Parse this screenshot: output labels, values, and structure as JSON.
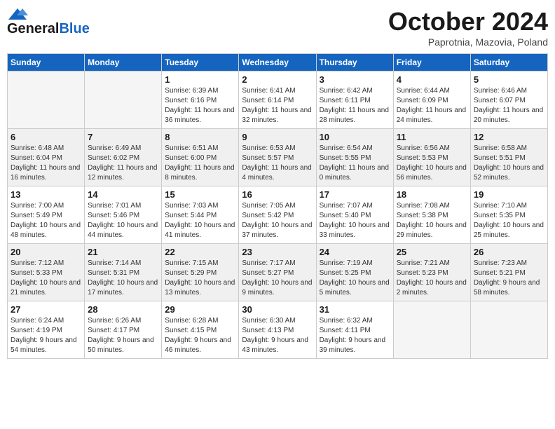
{
  "header": {
    "logo_line1": "General",
    "logo_line2": "Blue",
    "month": "October 2024",
    "location": "Paprotnia, Mazovia, Poland"
  },
  "weekdays": [
    "Sunday",
    "Monday",
    "Tuesday",
    "Wednesday",
    "Thursday",
    "Friday",
    "Saturday"
  ],
  "weeks": [
    [
      {
        "day": "",
        "sunrise": "",
        "sunset": "",
        "daylight": ""
      },
      {
        "day": "",
        "sunrise": "",
        "sunset": "",
        "daylight": ""
      },
      {
        "day": "1",
        "sunrise": "Sunrise: 6:39 AM",
        "sunset": "Sunset: 6:16 PM",
        "daylight": "Daylight: 11 hours and 36 minutes."
      },
      {
        "day": "2",
        "sunrise": "Sunrise: 6:41 AM",
        "sunset": "Sunset: 6:14 PM",
        "daylight": "Daylight: 11 hours and 32 minutes."
      },
      {
        "day": "3",
        "sunrise": "Sunrise: 6:42 AM",
        "sunset": "Sunset: 6:11 PM",
        "daylight": "Daylight: 11 hours and 28 minutes."
      },
      {
        "day": "4",
        "sunrise": "Sunrise: 6:44 AM",
        "sunset": "Sunset: 6:09 PM",
        "daylight": "Daylight: 11 hours and 24 minutes."
      },
      {
        "day": "5",
        "sunrise": "Sunrise: 6:46 AM",
        "sunset": "Sunset: 6:07 PM",
        "daylight": "Daylight: 11 hours and 20 minutes."
      }
    ],
    [
      {
        "day": "6",
        "sunrise": "Sunrise: 6:48 AM",
        "sunset": "Sunset: 6:04 PM",
        "daylight": "Daylight: 11 hours and 16 minutes."
      },
      {
        "day": "7",
        "sunrise": "Sunrise: 6:49 AM",
        "sunset": "Sunset: 6:02 PM",
        "daylight": "Daylight: 11 hours and 12 minutes."
      },
      {
        "day": "8",
        "sunrise": "Sunrise: 6:51 AM",
        "sunset": "Sunset: 6:00 PM",
        "daylight": "Daylight: 11 hours and 8 minutes."
      },
      {
        "day": "9",
        "sunrise": "Sunrise: 6:53 AM",
        "sunset": "Sunset: 5:57 PM",
        "daylight": "Daylight: 11 hours and 4 minutes."
      },
      {
        "day": "10",
        "sunrise": "Sunrise: 6:54 AM",
        "sunset": "Sunset: 5:55 PM",
        "daylight": "Daylight: 11 hours and 0 minutes."
      },
      {
        "day": "11",
        "sunrise": "Sunrise: 6:56 AM",
        "sunset": "Sunset: 5:53 PM",
        "daylight": "Daylight: 10 hours and 56 minutes."
      },
      {
        "day": "12",
        "sunrise": "Sunrise: 6:58 AM",
        "sunset": "Sunset: 5:51 PM",
        "daylight": "Daylight: 10 hours and 52 minutes."
      }
    ],
    [
      {
        "day": "13",
        "sunrise": "Sunrise: 7:00 AM",
        "sunset": "Sunset: 5:49 PM",
        "daylight": "Daylight: 10 hours and 48 minutes."
      },
      {
        "day": "14",
        "sunrise": "Sunrise: 7:01 AM",
        "sunset": "Sunset: 5:46 PM",
        "daylight": "Daylight: 10 hours and 44 minutes."
      },
      {
        "day": "15",
        "sunrise": "Sunrise: 7:03 AM",
        "sunset": "Sunset: 5:44 PM",
        "daylight": "Daylight: 10 hours and 41 minutes."
      },
      {
        "day": "16",
        "sunrise": "Sunrise: 7:05 AM",
        "sunset": "Sunset: 5:42 PM",
        "daylight": "Daylight: 10 hours and 37 minutes."
      },
      {
        "day": "17",
        "sunrise": "Sunrise: 7:07 AM",
        "sunset": "Sunset: 5:40 PM",
        "daylight": "Daylight: 10 hours and 33 minutes."
      },
      {
        "day": "18",
        "sunrise": "Sunrise: 7:08 AM",
        "sunset": "Sunset: 5:38 PM",
        "daylight": "Daylight: 10 hours and 29 minutes."
      },
      {
        "day": "19",
        "sunrise": "Sunrise: 7:10 AM",
        "sunset": "Sunset: 5:35 PM",
        "daylight": "Daylight: 10 hours and 25 minutes."
      }
    ],
    [
      {
        "day": "20",
        "sunrise": "Sunrise: 7:12 AM",
        "sunset": "Sunset: 5:33 PM",
        "daylight": "Daylight: 10 hours and 21 minutes."
      },
      {
        "day": "21",
        "sunrise": "Sunrise: 7:14 AM",
        "sunset": "Sunset: 5:31 PM",
        "daylight": "Daylight: 10 hours and 17 minutes."
      },
      {
        "day": "22",
        "sunrise": "Sunrise: 7:15 AM",
        "sunset": "Sunset: 5:29 PM",
        "daylight": "Daylight: 10 hours and 13 minutes."
      },
      {
        "day": "23",
        "sunrise": "Sunrise: 7:17 AM",
        "sunset": "Sunset: 5:27 PM",
        "daylight": "Daylight: 10 hours and 9 minutes."
      },
      {
        "day": "24",
        "sunrise": "Sunrise: 7:19 AM",
        "sunset": "Sunset: 5:25 PM",
        "daylight": "Daylight: 10 hours and 5 minutes."
      },
      {
        "day": "25",
        "sunrise": "Sunrise: 7:21 AM",
        "sunset": "Sunset: 5:23 PM",
        "daylight": "Daylight: 10 hours and 2 minutes."
      },
      {
        "day": "26",
        "sunrise": "Sunrise: 7:23 AM",
        "sunset": "Sunset: 5:21 PM",
        "daylight": "Daylight: 9 hours and 58 minutes."
      }
    ],
    [
      {
        "day": "27",
        "sunrise": "Sunrise: 6:24 AM",
        "sunset": "Sunset: 4:19 PM",
        "daylight": "Daylight: 9 hours and 54 minutes."
      },
      {
        "day": "28",
        "sunrise": "Sunrise: 6:26 AM",
        "sunset": "Sunset: 4:17 PM",
        "daylight": "Daylight: 9 hours and 50 minutes."
      },
      {
        "day": "29",
        "sunrise": "Sunrise: 6:28 AM",
        "sunset": "Sunset: 4:15 PM",
        "daylight": "Daylight: 9 hours and 46 minutes."
      },
      {
        "day": "30",
        "sunrise": "Sunrise: 6:30 AM",
        "sunset": "Sunset: 4:13 PM",
        "daylight": "Daylight: 9 hours and 43 minutes."
      },
      {
        "day": "31",
        "sunrise": "Sunrise: 6:32 AM",
        "sunset": "Sunset: 4:11 PM",
        "daylight": "Daylight: 9 hours and 39 minutes."
      },
      {
        "day": "",
        "sunrise": "",
        "sunset": "",
        "daylight": ""
      },
      {
        "day": "",
        "sunrise": "",
        "sunset": "",
        "daylight": ""
      }
    ]
  ]
}
